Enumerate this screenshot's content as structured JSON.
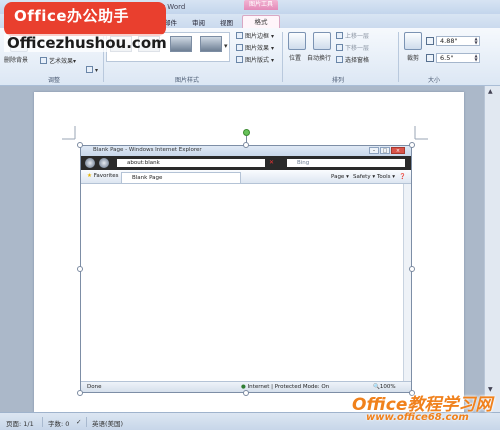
{
  "window": {
    "title": "ft Word",
    "context_tab_header": "图片工具"
  },
  "tabs": [
    {
      "label": "邮件"
    },
    {
      "label": "审阅"
    },
    {
      "label": "视图"
    },
    {
      "label": "格式",
      "active": true
    }
  ],
  "watermark_top": {
    "brand": "Office办公助手",
    "url": "Officezhushou.com"
  },
  "ribbon": {
    "adjust_group": {
      "label": "调整",
      "remove_bg": "删除背景",
      "art_effects": "艺术效果",
      "arrow": "▾"
    },
    "styles_group": {
      "label": "图片样式",
      "border": "图片边框",
      "effects": "图片效果",
      "layout": "图片版式",
      "dropdown_arrow": "▾"
    },
    "arrange_group": {
      "label": "排列",
      "position": "位置",
      "wrap": "自动换行",
      "bring_forward": "上移一层",
      "send_backward": "下移一层",
      "selection_pane": "选择窗格"
    },
    "size_group": {
      "label": "大小",
      "crop": "裁剪",
      "height": "4.88\"",
      "width": "6.5\""
    }
  },
  "ie": {
    "title": "Blank Page - Windows Internet Explorer",
    "url": "about:blank",
    "search_placeholder": "Bing",
    "favorites": "Favorites",
    "tab": "Blank Page",
    "toolbar": {
      "page": "Page ▾",
      "safety": "Safety ▾",
      "tools": "Tools ▾"
    },
    "window_buttons": {
      "min": "–",
      "max": "□",
      "close": "×"
    },
    "status_left": "Done",
    "status_middle": "Internet | Protected Mode: On",
    "zoom": "100%"
  },
  "statusbar": {
    "page": "页面: 1/1",
    "words": "字数: 0",
    "language": "英语(美国)"
  },
  "watermark_bottom": {
    "brand": "Office教程学习网",
    "url": "www.office68.com"
  },
  "colors": {
    "context_tab": "#e48ab8",
    "logo_red": "#e93f2e",
    "watermark_orange": "#f0811c"
  }
}
